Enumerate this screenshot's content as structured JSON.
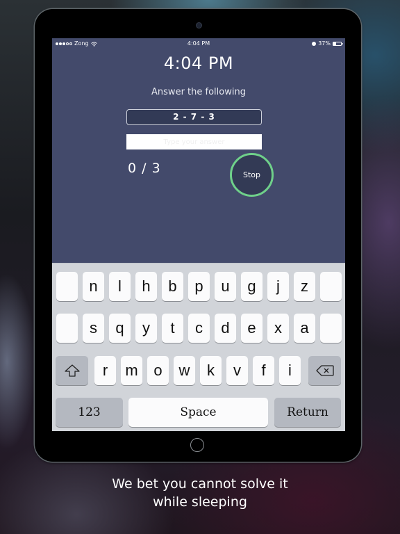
{
  "status_bar": {
    "carrier": "Zong",
    "signal_bars_filled": 3,
    "signal_bars_total": 5,
    "time": "4:04 PM",
    "battery_percent": "37%",
    "battery_level": 0.37
  },
  "alarm": {
    "clock": "4:04 PM",
    "prompt": "Answer the following",
    "problem": "2 - 7 - 3",
    "answer_value": "",
    "answer_placeholder": "Type your answer",
    "score": "0 / 3",
    "stop_label": "Stop"
  },
  "keyboard": {
    "row1": [
      "",
      "n",
      "l",
      "h",
      "b",
      "p",
      "u",
      "g",
      "j",
      "z",
      ""
    ],
    "row2": [
      "",
      "s",
      "q",
      "y",
      "t",
      "c",
      "d",
      "e",
      "x",
      "a",
      ""
    ],
    "row3": [
      "r",
      "m",
      "o",
      "w",
      "k",
      "v",
      "f",
      "i"
    ],
    "numbers_label": "123",
    "space_label": "Space",
    "return_label": "Return"
  },
  "tagline": {
    "line1": "We bet you cannot solve it",
    "line2": "while sleeping"
  },
  "colors": {
    "app_background": "#434a6b",
    "stop_ring": "#6fd08a",
    "keyboard_background": "#d1d4d9"
  }
}
